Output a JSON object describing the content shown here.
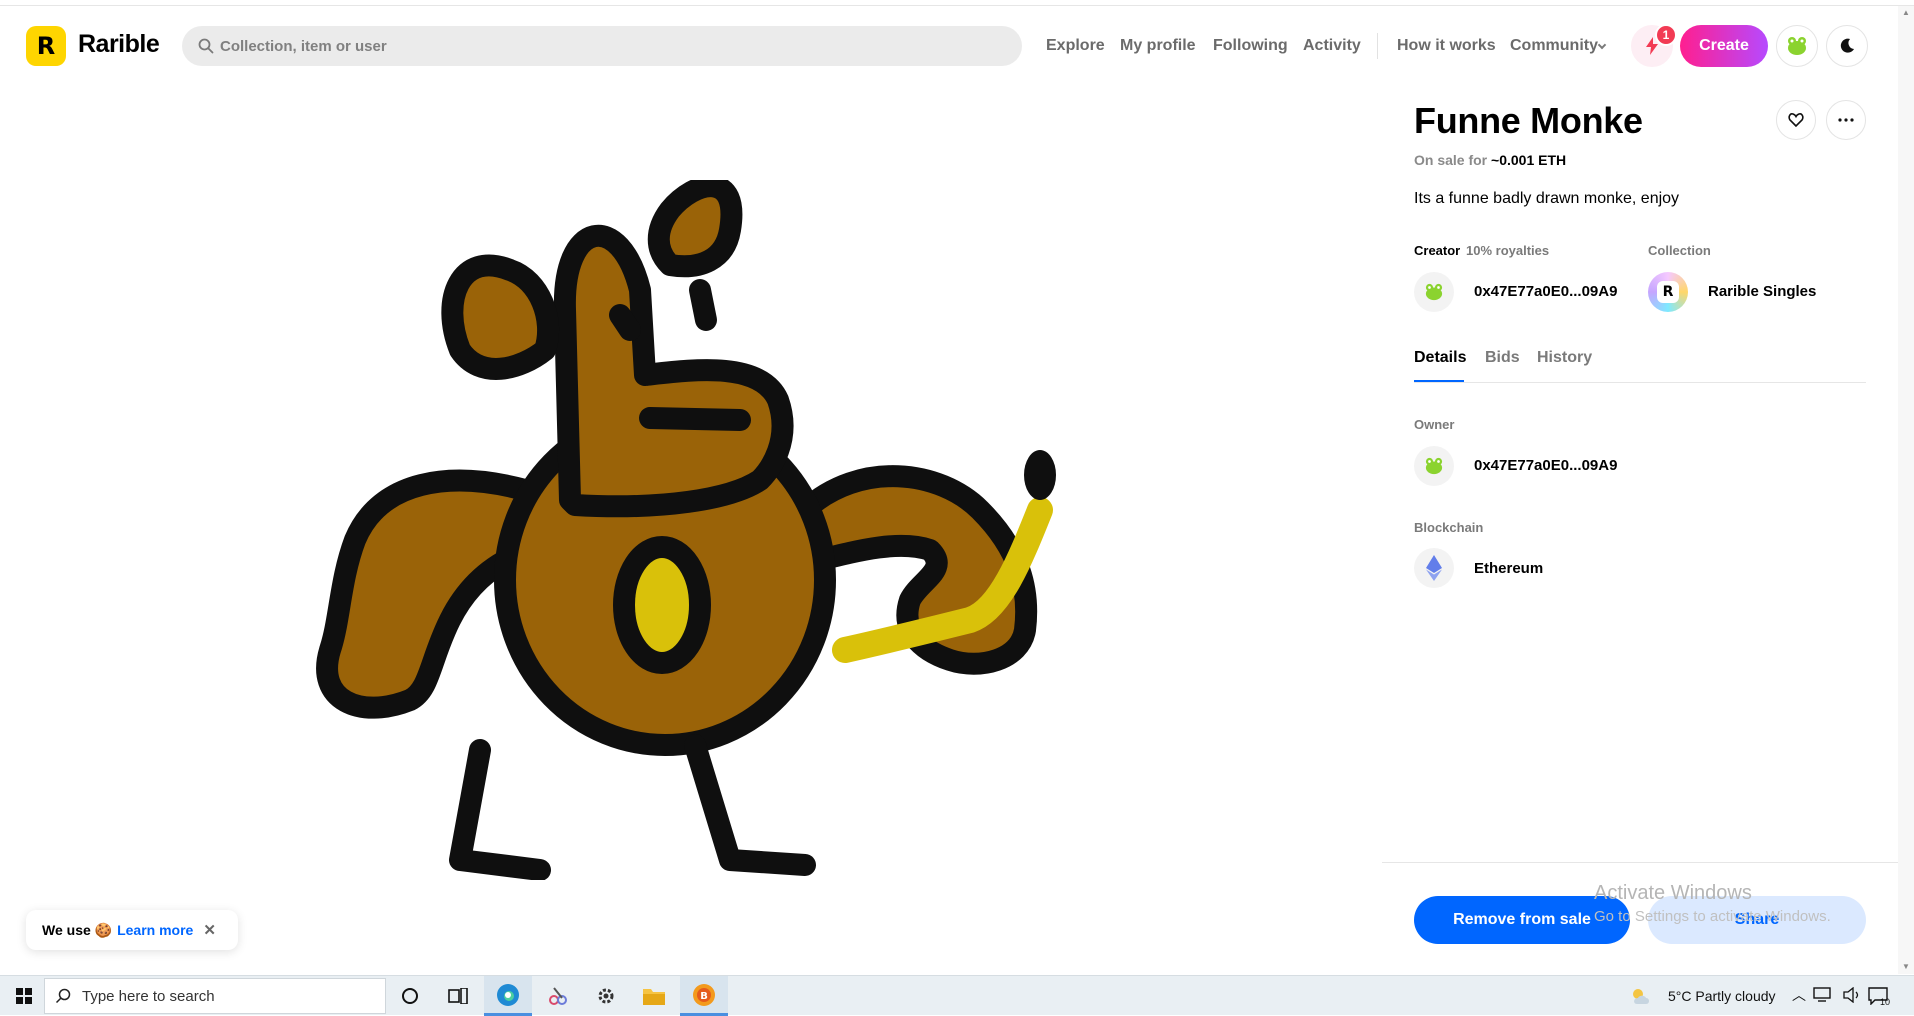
{
  "header": {
    "brand": "Rarible",
    "search_placeholder": "Collection, item or user",
    "nav": [
      "Explore",
      "My profile",
      "Following",
      "Activity",
      "How it works",
      "Community"
    ],
    "notification_count": "1",
    "create_label": "Create"
  },
  "item": {
    "title": "Funne Monke",
    "sale_prefix": "On sale for",
    "sale_price": "~0.001 ETH",
    "description": "Its a funne badly drawn monke, enjoy",
    "creator_label": "Creator",
    "royalties": "10% royalties",
    "creator_address": "0x47E77a0E0...09A9",
    "collection_label": "Collection",
    "collection_name": "Rarible Singles",
    "tabs": [
      "Details",
      "Bids",
      "History"
    ],
    "owner_label": "Owner",
    "owner_address": "0x47E77a0E0...09A9",
    "blockchain_label": "Blockchain",
    "blockchain_name": "Ethereum",
    "remove_label": "Remove from sale",
    "share_label": "Share"
  },
  "cookie": {
    "text": "We use 🍪",
    "link": "Learn more",
    "close": "✕"
  },
  "watermark": {
    "line1": "Activate Windows",
    "line2": "Go to Settings to activate Windows."
  },
  "taskbar": {
    "search_placeholder": "Type here to search",
    "weather": "5°C  Partly cloudy",
    "notification_count": "10"
  },
  "colors": {
    "accent": "#0066ff",
    "brand_yellow": "#fed500",
    "create_gradient_start": "#ff1f8f",
    "create_gradient_end": "#b64aff"
  }
}
